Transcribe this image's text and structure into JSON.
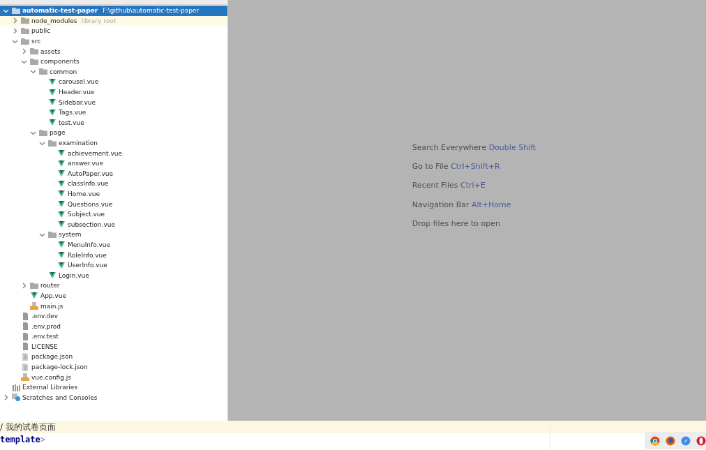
{
  "project_tree": [
    {
      "name": "automatic-test-paper",
      "kind": "folder",
      "path": "F:\\github\\automatic-test-paper",
      "selected": true,
      "expanded": true,
      "children": [
        {
          "name": "node_modules",
          "kind": "folder",
          "hint": "library root",
          "highlighted": true,
          "selected": false,
          "expanded": false
        },
        {
          "name": "public",
          "kind": "folder",
          "selected": false,
          "expanded": false
        },
        {
          "name": "src",
          "kind": "folder",
          "selected": false,
          "expanded": true,
          "children": [
            {
              "name": "assets",
              "kind": "folder",
              "selected": false,
              "expanded": false
            },
            {
              "name": "components",
              "kind": "folder",
              "selected": false,
              "expanded": true,
              "children": [
                {
                  "name": "common",
                  "kind": "folder",
                  "selected": false,
                  "expanded": true,
                  "children": [
                    {
                      "name": "carousel.vue",
                      "kind": "vue",
                      "selected": false
                    },
                    {
                      "name": "Header.vue",
                      "kind": "vue",
                      "selected": false
                    },
                    {
                      "name": "Sidebar.vue",
                      "kind": "vue",
                      "selected": false
                    },
                    {
                      "name": "Tags.vue",
                      "kind": "vue",
                      "selected": false
                    },
                    {
                      "name": "test.vue",
                      "kind": "vue",
                      "selected": false
                    }
                  ]
                },
                {
                  "name": "page",
                  "kind": "folder",
                  "selected": false,
                  "expanded": true,
                  "children": [
                    {
                      "name": "examination",
                      "kind": "folder",
                      "selected": false,
                      "expanded": true,
                      "children": [
                        {
                          "name": "achievement.vue",
                          "kind": "vue",
                          "selected": false
                        },
                        {
                          "name": "answer.vue",
                          "kind": "vue",
                          "selected": false
                        },
                        {
                          "name": "AutoPaper.vue",
                          "kind": "vue",
                          "selected": false
                        },
                        {
                          "name": "classInfo.vue",
                          "kind": "vue",
                          "selected": false
                        },
                        {
                          "name": "Home.vue",
                          "kind": "vue",
                          "selected": false
                        },
                        {
                          "name": "Questions.vue",
                          "kind": "vue",
                          "selected": false
                        },
                        {
                          "name": "Subject.vue",
                          "kind": "vue",
                          "selected": false
                        },
                        {
                          "name": "subsection.vue",
                          "kind": "vue",
                          "selected": false
                        }
                      ]
                    },
                    {
                      "name": "system",
                      "kind": "folder",
                      "selected": false,
                      "expanded": true,
                      "children": [
                        {
                          "name": "MenuInfo.vue",
                          "kind": "vue",
                          "selected": false
                        },
                        {
                          "name": "RoleInfo.vue",
                          "kind": "vue",
                          "selected": false
                        },
                        {
                          "name": "UserInfo.vue",
                          "kind": "vue",
                          "selected": false
                        }
                      ]
                    },
                    {
                      "name": "Login.vue",
                      "kind": "vue",
                      "selected": false
                    }
                  ]
                }
              ]
            },
            {
              "name": "router",
              "kind": "folder",
              "selected": false,
              "expanded": false
            },
            {
              "name": "App.vue",
              "kind": "vue",
              "selected": false
            },
            {
              "name": "main.js",
              "kind": "js",
              "selected": false
            }
          ]
        },
        {
          "name": ".env.dev",
          "kind": "text",
          "selected": false
        },
        {
          "name": ".env.prod",
          "kind": "text",
          "selected": false
        },
        {
          "name": ".env.test",
          "kind": "text",
          "selected": false
        },
        {
          "name": "LICENSE",
          "kind": "text",
          "selected": false
        },
        {
          "name": "package.json",
          "kind": "json",
          "selected": false
        },
        {
          "name": "package-lock.json",
          "kind": "json",
          "selected": false
        },
        {
          "name": "vue.config.js",
          "kind": "js",
          "selected": false
        }
      ]
    },
    {
      "name": "External Libraries",
      "kind": "libraries",
      "selected": false
    },
    {
      "name": "Scratches and Consoles",
      "kind": "scratches",
      "selected": false,
      "expanded": false
    }
  ],
  "editor_hints": [
    {
      "action": "Search Everywhere",
      "shortcut": "Double Shift"
    },
    {
      "action": "Go to File",
      "shortcut": "Ctrl+Shift+R"
    },
    {
      "action": "Recent Files",
      "shortcut": "Ctrl+E"
    },
    {
      "action": "Navigation Bar",
      "shortcut": "Alt+Home"
    },
    {
      "action": "Drop files here to open"
    }
  ],
  "code_lines": [
    {
      "kind": "comment",
      "text": "/ 我的试卷页面",
      "current": true
    },
    {
      "kind": "tag",
      "name": "template",
      "close": ">",
      "current": false
    }
  ],
  "browser_icons": [
    {
      "kind": "chrome"
    },
    {
      "kind": "firefox"
    },
    {
      "kind": "safari"
    },
    {
      "kind": "opera"
    }
  ]
}
